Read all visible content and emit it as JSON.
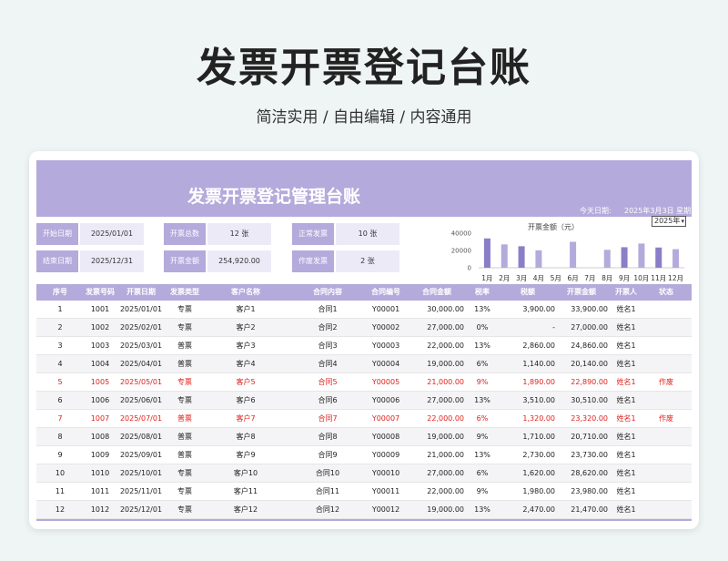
{
  "header": {
    "title": "发票开票登记台账",
    "subtitle": "简洁实用 / 自由编辑 / 内容通用"
  },
  "banner": {
    "title": "发票开票登记管理台账",
    "today_label": "今天日期:",
    "today_value": "2025年3月3日  星期一"
  },
  "stats": {
    "start_date": {
      "label": "开始日期",
      "value": "2025/01/01"
    },
    "end_date": {
      "label": "结束日期",
      "value": "2025/12/31"
    },
    "total_count": {
      "label": "开票总数",
      "value": "12 张"
    },
    "total_amount": {
      "label": "开票金额",
      "value": "254,920.00"
    },
    "normal_count": {
      "label": "正常发票",
      "value": "10 张"
    },
    "void_count": {
      "label": "作废发票",
      "value": "2 张"
    }
  },
  "year_select": {
    "value": "2025年"
  },
  "chart_data": {
    "type": "bar",
    "title": "开票金额（元）",
    "categories": [
      "1月",
      "2月",
      "3月",
      "4月",
      "5月",
      "6月",
      "7月",
      "8月",
      "9月",
      "10月",
      "11月",
      "12月"
    ],
    "values": [
      33900,
      27000,
      24860,
      20140,
      0,
      30000,
      0,
      20700,
      23730,
      28000,
      23400,
      21470
    ],
    "ylim": [
      0,
      40000
    ],
    "yticks": [
      "0",
      "20000",
      "40000"
    ],
    "ytick_values": [
      0,
      20000,
      40000
    ],
    "grid": false,
    "colors": {
      "dark": "#8b7ec8",
      "light": "#b4aadb"
    }
  },
  "table": {
    "columns": [
      "序号",
      "发票号码",
      "开票日期",
      "发票类型",
      "客户名称",
      "合同内容",
      "合同编号",
      "合同金额",
      "税率",
      "税额",
      "开票金额",
      "开票人",
      "状态"
    ],
    "rows": [
      {
        "cells": [
          "1",
          "1001",
          "2025/01/01",
          "专票",
          "客户1",
          "合同1",
          "Y00001",
          "30,000.00",
          "13%",
          "3,900.00",
          "33,900.00",
          "姓名1",
          ""
        ],
        "void": false
      },
      {
        "cells": [
          "2",
          "1002",
          "2025/02/01",
          "专票",
          "客户2",
          "合同2",
          "Y00002",
          "27,000.00",
          "0%",
          "-",
          "27,000.00",
          "姓名1",
          ""
        ],
        "void": false
      },
      {
        "cells": [
          "3",
          "1003",
          "2025/03/01",
          "普票",
          "客户3",
          "合同3",
          "Y00003",
          "22,000.00",
          "13%",
          "2,860.00",
          "24,860.00",
          "姓名1",
          ""
        ],
        "void": false
      },
      {
        "cells": [
          "4",
          "1004",
          "2025/04/01",
          "普票",
          "客户4",
          "合同4",
          "Y00004",
          "19,000.00",
          "6%",
          "1,140.00",
          "20,140.00",
          "姓名1",
          ""
        ],
        "void": false
      },
      {
        "cells": [
          "5",
          "1005",
          "2025/05/01",
          "专票",
          "客户5",
          "合同5",
          "Y00005",
          "21,000.00",
          "9%",
          "1,890.00",
          "22,890.00",
          "姓名1",
          "作废"
        ],
        "void": true
      },
      {
        "cells": [
          "6",
          "1006",
          "2025/06/01",
          "专票",
          "客户6",
          "合同6",
          "Y00006",
          "27,000.00",
          "13%",
          "3,510.00",
          "30,510.00",
          "姓名1",
          ""
        ],
        "void": false
      },
      {
        "cells": [
          "7",
          "1007",
          "2025/07/01",
          "普票",
          "客户7",
          "合同7",
          "Y00007",
          "22,000.00",
          "6%",
          "1,320.00",
          "23,320.00",
          "姓名1",
          "作废"
        ],
        "void": true
      },
      {
        "cells": [
          "8",
          "1008",
          "2025/08/01",
          "普票",
          "客户8",
          "合同8",
          "Y00008",
          "19,000.00",
          "9%",
          "1,710.00",
          "20,710.00",
          "姓名1",
          ""
        ],
        "void": false
      },
      {
        "cells": [
          "9",
          "1009",
          "2025/09/01",
          "普票",
          "客户9",
          "合同9",
          "Y00009",
          "21,000.00",
          "13%",
          "2,730.00",
          "23,730.00",
          "姓名1",
          ""
        ],
        "void": false
      },
      {
        "cells": [
          "10",
          "1010",
          "2025/10/01",
          "专票",
          "客户10",
          "合同10",
          "Y00010",
          "27,000.00",
          "6%",
          "1,620.00",
          "28,620.00",
          "姓名1",
          ""
        ],
        "void": false
      },
      {
        "cells": [
          "11",
          "1011",
          "2025/11/01",
          "专票",
          "客户11",
          "合同11",
          "Y00011",
          "22,000.00",
          "9%",
          "1,980.00",
          "23,980.00",
          "姓名1",
          ""
        ],
        "void": false
      },
      {
        "cells": [
          "12",
          "1012",
          "2025/12/01",
          "专票",
          "客户12",
          "合同12",
          "Y00012",
          "19,000.00",
          "13%",
          "2,470.00",
          "21,470.00",
          "姓名1",
          ""
        ],
        "void": false
      }
    ]
  }
}
